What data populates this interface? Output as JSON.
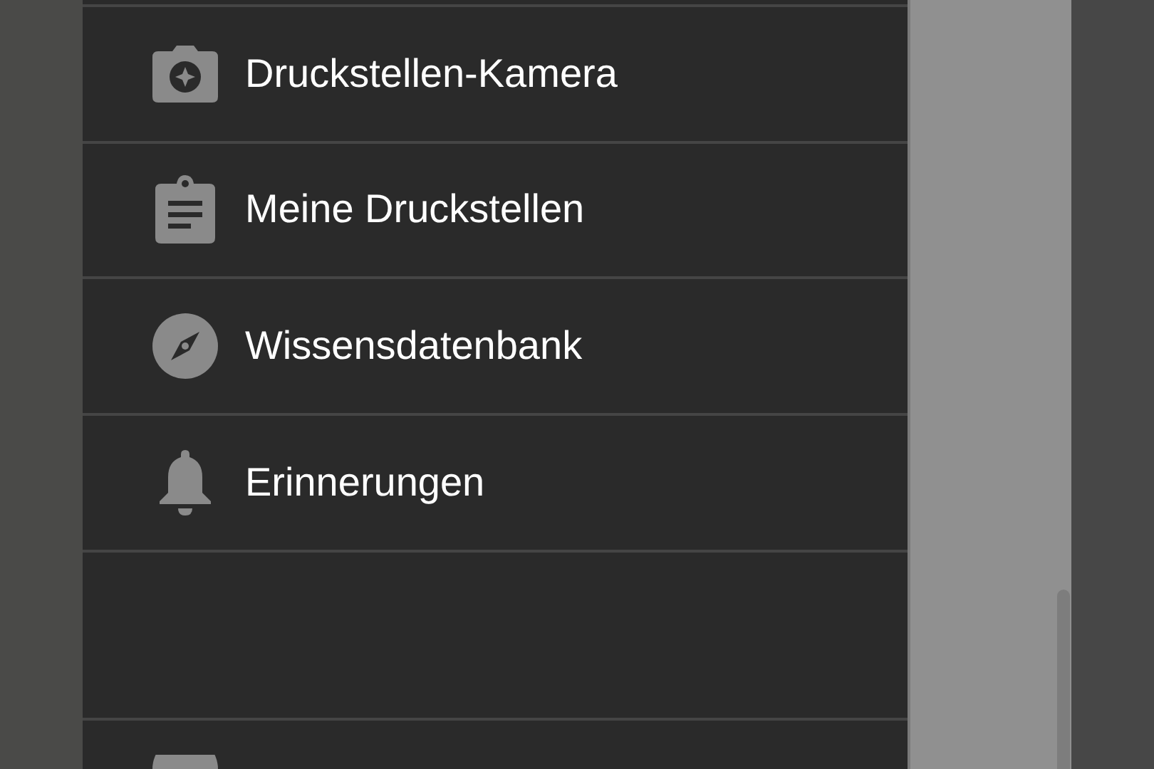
{
  "menu_items": [
    {
      "label": "Druckstellen-Kamera"
    },
    {
      "label": "Meine Druckstellen"
    },
    {
      "label": "Wissensdatenbank"
    },
    {
      "label": "Erinnerungen"
    }
  ]
}
